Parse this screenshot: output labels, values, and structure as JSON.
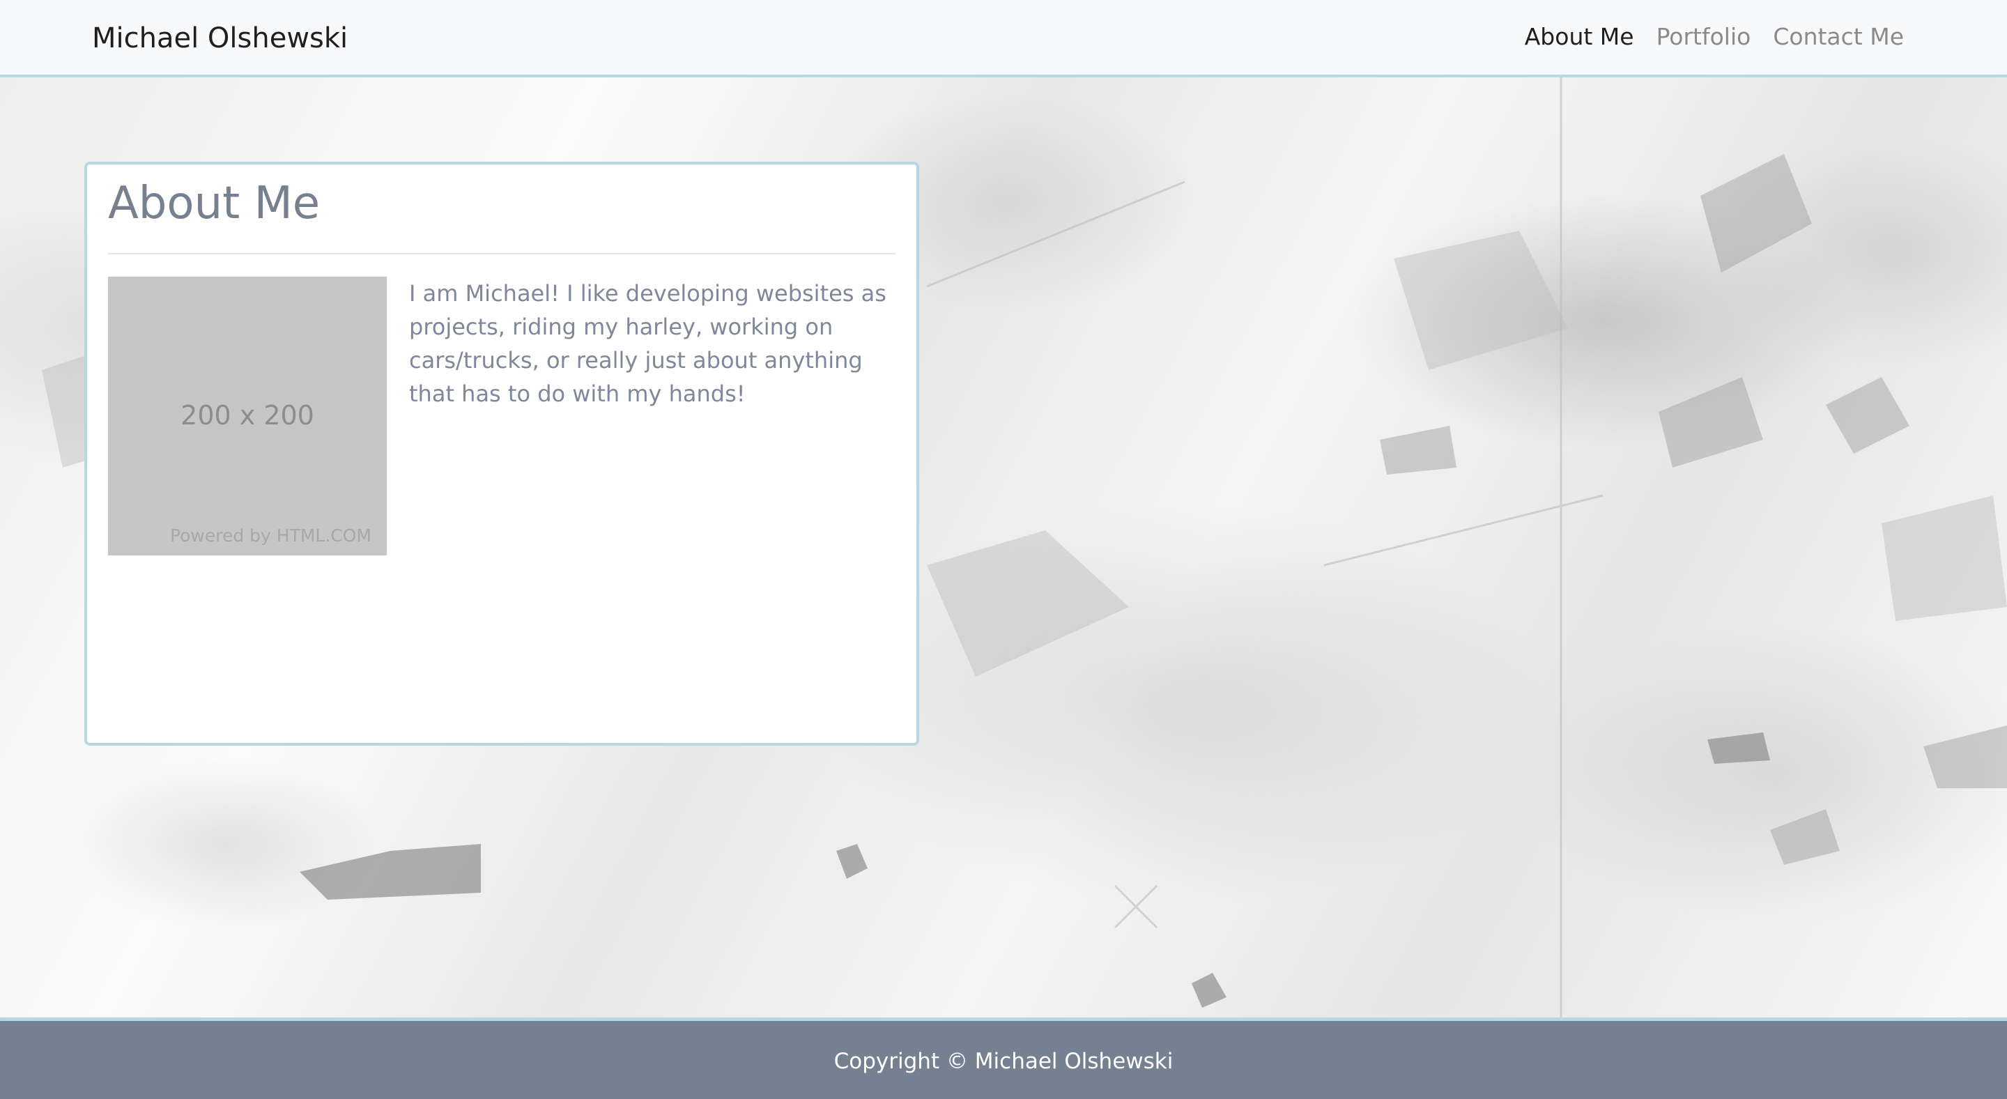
{
  "navbar": {
    "brand": "Michael Olshewski",
    "links": [
      {
        "label": "About Me",
        "active": true
      },
      {
        "label": "Portfolio",
        "active": false
      },
      {
        "label": "Contact Me",
        "active": false
      }
    ]
  },
  "about": {
    "title": "About Me",
    "image": {
      "dimensions": "200 x 200",
      "powered_by": "Powered by HTML.COM"
    },
    "bio": "I am Michael! I like developing websites as projects, riding my harley, working on cars/trucks, or really just about anything that has to do with my hands!"
  },
  "footer": {
    "copyright": "Copyright © Michael Olshewski"
  },
  "colors": {
    "navbar_bg": "#f8f9fa",
    "accent_border": "#b9d6e1",
    "footer_bg": "#758091",
    "heading_text": "#77808f",
    "body_text": "#80879a"
  }
}
